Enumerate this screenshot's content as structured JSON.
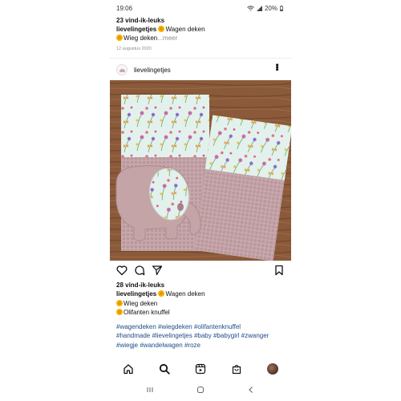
{
  "status_bar": {
    "time": "19:06",
    "battery": "20%"
  },
  "previous_post": {
    "likes": "23 vind-ik-leuks",
    "username": "lievelingetjes",
    "line1": "Wagen deken",
    "line2": "Wieg deken",
    "more": "...meer",
    "date": "12 augustus 2020"
  },
  "post": {
    "username": "lievelingetjes",
    "more_icon": "more-vertical-icon",
    "image_alt": "Kinderwagen deken, wiegdeken en olifant knuffel"
  },
  "actions": {
    "icons": [
      "heart-icon",
      "comment-icon",
      "share-icon",
      "bookmark-icon"
    ]
  },
  "caption": {
    "likes": "28 vind-ik-leuks",
    "username": "lievelingetjes",
    "line1": "Wagen deken",
    "line2": "Wieg deken",
    "line3": "Olifanten knuffel",
    "hashtags_1": "#wagendeken #wiegdeken #olifantenknuffel",
    "hashtags_2": "#handmade #lievelingetjes #baby #babygirl #zwanger",
    "hashtags_3": "#wiegje #wandelwagen #roze"
  },
  "bottom_nav": {
    "items": [
      "home-icon",
      "search-icon",
      "reels-icon",
      "shop-icon",
      "profile-avatar"
    ]
  },
  "system_nav": {
    "items": [
      "recents-icon",
      "home-circle-icon",
      "back-icon"
    ]
  },
  "colors": {
    "hashtag": "#1e4a8a",
    "muted": "#8e8e8e",
    "wood": "#8a5a3a",
    "waffle_pink": "#c9a9ad",
    "floral_mint": "#e3f1ec"
  }
}
